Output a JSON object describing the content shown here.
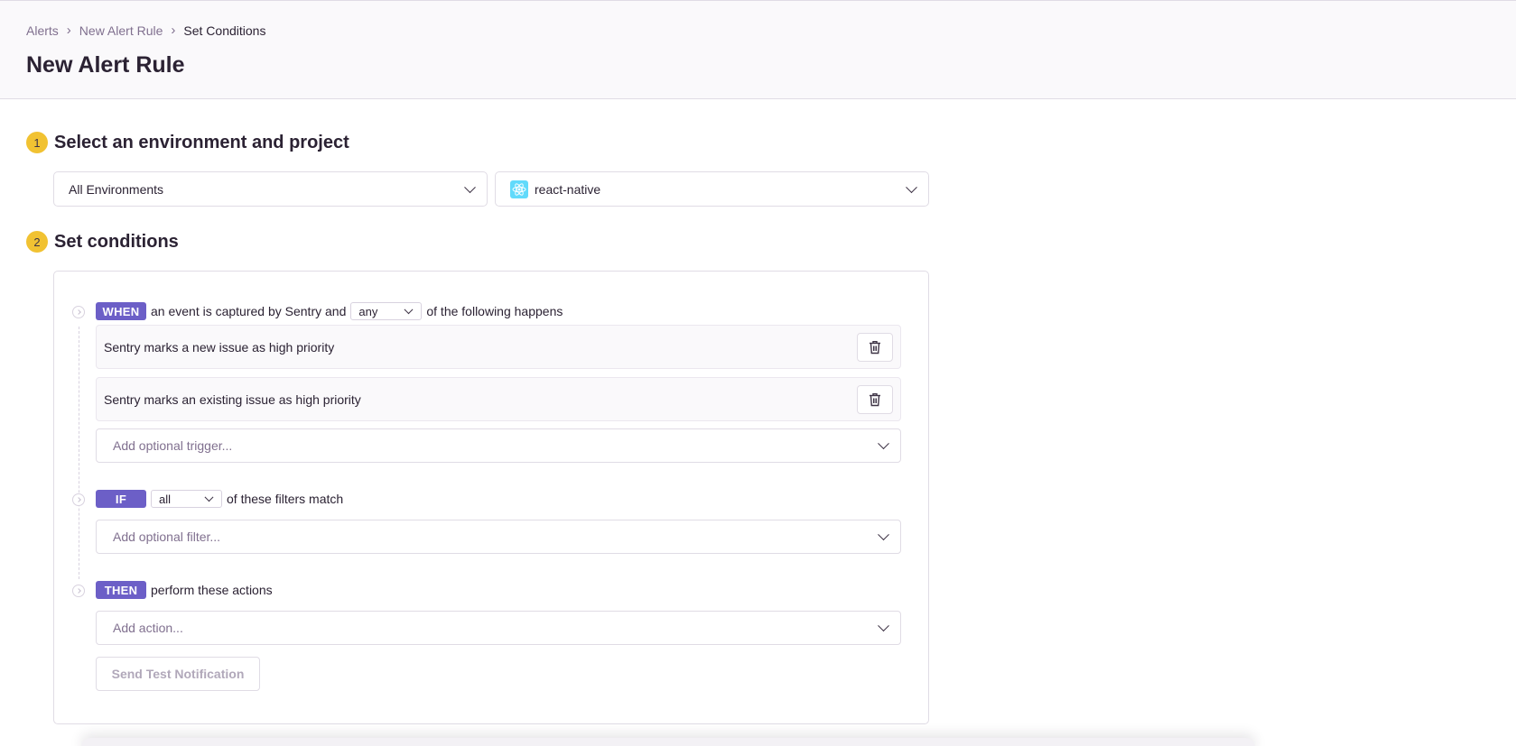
{
  "breadcrumb": {
    "items": [
      "Alerts",
      "New Alert Rule"
    ],
    "current": "Set Conditions"
  },
  "page": {
    "title": "New Alert Rule"
  },
  "step1": {
    "number": "1",
    "title": "Select an environment and project",
    "environment": "All Environments",
    "project": "react-native"
  },
  "step2": {
    "number": "2",
    "title": "Set conditions",
    "when": {
      "tag": "WHEN",
      "prefix": "an event is captured by Sentry and",
      "match": "any",
      "suffix": "of the following happens",
      "conditions": [
        "Sentry marks a new issue as high priority",
        "Sentry marks an existing issue as high priority"
      ],
      "add_placeholder": "Add optional trigger..."
    },
    "if": {
      "tag": "IF",
      "match": "all",
      "suffix": "of these filters match",
      "add_placeholder": "Add optional filter..."
    },
    "then": {
      "tag": "THEN",
      "suffix": "perform these actions",
      "add_placeholder": "Add action..."
    },
    "test_button": "Send Test Notification"
  },
  "colors": {
    "accent": "#6c5fc7",
    "step_badge": "#f1c232",
    "react_brand": "#61dafb"
  }
}
